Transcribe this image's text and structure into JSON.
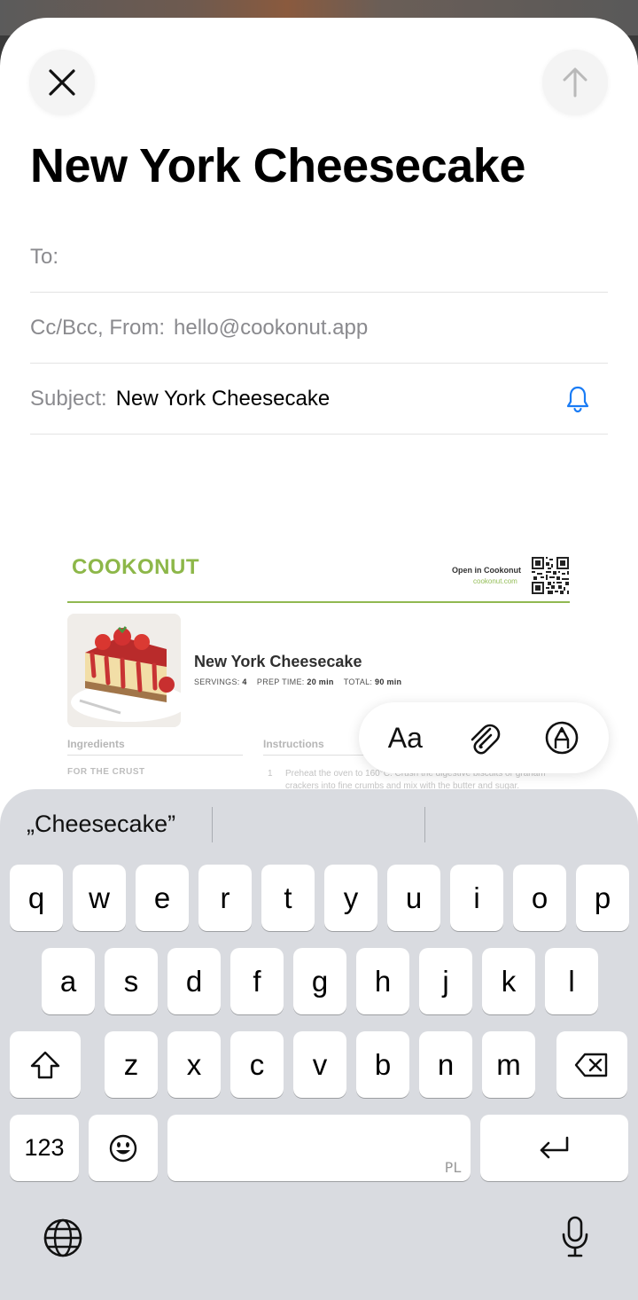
{
  "compose": {
    "title": "New York Cheesecake",
    "to_label": "To:",
    "cc_label": "Cc/Bcc, From:",
    "from_value": "hello@cookonut.app",
    "subject_label": "Subject:",
    "subject_value": "New York Cheesecake"
  },
  "attachment": {
    "logo": "COOKONUT",
    "open_label": "Open in Cookonut",
    "url": "cookonut.com",
    "recipe_title": "New York Cheesecake",
    "servings_label": "SERVINGS:",
    "servings_value": "4",
    "prep_label": "PREP TIME:",
    "prep_value": "20 min",
    "total_label": "TOTAL:",
    "total_value": "90 min",
    "ingredients_heading": "Ingredients",
    "instructions_heading": "Instructions",
    "crust_heading": "FOR THE CRUST",
    "step_number": "1",
    "step_text": "Preheat the oven to 160°C. Crush the digestive biscuits or graham crackers into fine crumbs and mix with the butter and sugar."
  },
  "format_bar": {
    "text_label": "Aa",
    "attach_icon": "paperclip-icon",
    "markup_icon": "markup-pen-icon"
  },
  "keyboard": {
    "suggestion": "„Cheesecake”",
    "row1": [
      "q",
      "w",
      "e",
      "r",
      "t",
      "y",
      "u",
      "i",
      "o",
      "p"
    ],
    "row2": [
      "a",
      "s",
      "d",
      "f",
      "g",
      "h",
      "j",
      "k",
      "l"
    ],
    "row3": [
      "z",
      "x",
      "c",
      "v",
      "b",
      "n",
      "m"
    ],
    "numbers_label": "123",
    "space_lang": "PL"
  },
  "colors": {
    "accent_blue": "#1a7cf5",
    "brand_green": "#84b13a"
  }
}
